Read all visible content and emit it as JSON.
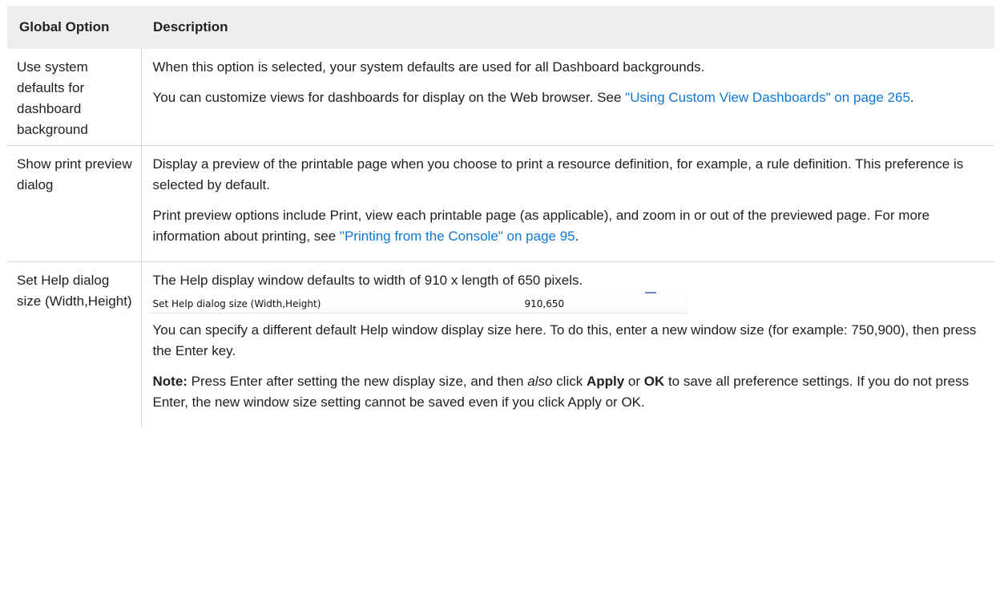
{
  "table": {
    "headers": {
      "option": "Global Option",
      "description": "Description"
    },
    "rows": [
      {
        "option": "Use system defaults for dashboard background",
        "p1": "When this option is selected, your system defaults are used for all Dashboard backgrounds.",
        "p2_text": "You can customize views for dashboards for display on the Web browser. See ",
        "p2_link": "\"Using Custom View Dashboards\" on page 265",
        "p2_end": "."
      },
      {
        "option": "Show print preview dialog",
        "p1": "Display a preview of the printable page when you choose to print a resource definition, for example, a rule definition. This preference is selected by default.",
        "p2_text": "Print preview options include Print, view each printable page (as applicable), and zoom in or out of the previewed page. For more information about printing, see ",
        "p2_link": "\"Printing from the Console\" on page 95",
        "p2_end": "."
      },
      {
        "option": "Set Help dialog size (Width,Height)",
        "p1": "The Help display window defaults to width of 910 x length of 650 pixels.",
        "pref_label": "Set Help dialog size (Width,Height)",
        "pref_value": "910,650",
        "p2": "You can specify a different default Help window display size here. To do this, enter a new window size (for example: 750,900), then press the Enter key.",
        "note_label": "Note:",
        "note_a": " Press Enter after setting the new display size, and then ",
        "note_also": "also",
        "note_b": " click ",
        "note_apply": "Apply",
        "note_c": " or ",
        "note_ok": "OK",
        "note_d": " to save all preference settings. If you do not press Enter, the new window size setting cannot be saved even if you click Apply or OK."
      }
    ]
  },
  "colors": {
    "link": "#0f78d7",
    "header_bg": "#eeeeee",
    "border": "#d6d6d6"
  }
}
